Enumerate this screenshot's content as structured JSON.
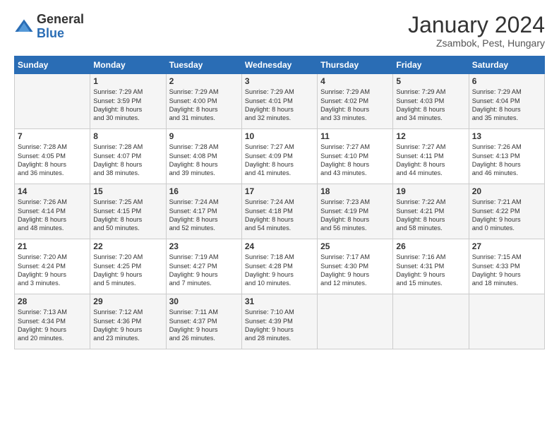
{
  "logo": {
    "general": "General",
    "blue": "Blue"
  },
  "title": "January 2024",
  "location": "Zsambok, Pest, Hungary",
  "days_header": [
    "Sunday",
    "Monday",
    "Tuesday",
    "Wednesday",
    "Thursday",
    "Friday",
    "Saturday"
  ],
  "weeks": [
    [
      {
        "day": "",
        "content": ""
      },
      {
        "day": "1",
        "content": "Sunrise: 7:29 AM\nSunset: 3:59 PM\nDaylight: 8 hours\nand 30 minutes."
      },
      {
        "day": "2",
        "content": "Sunrise: 7:29 AM\nSunset: 4:00 PM\nDaylight: 8 hours\nand 31 minutes."
      },
      {
        "day": "3",
        "content": "Sunrise: 7:29 AM\nSunset: 4:01 PM\nDaylight: 8 hours\nand 32 minutes."
      },
      {
        "day": "4",
        "content": "Sunrise: 7:29 AM\nSunset: 4:02 PM\nDaylight: 8 hours\nand 33 minutes."
      },
      {
        "day": "5",
        "content": "Sunrise: 7:29 AM\nSunset: 4:03 PM\nDaylight: 8 hours\nand 34 minutes."
      },
      {
        "day": "6",
        "content": "Sunrise: 7:29 AM\nSunset: 4:04 PM\nDaylight: 8 hours\nand 35 minutes."
      }
    ],
    [
      {
        "day": "7",
        "content": "Sunrise: 7:28 AM\nSunset: 4:05 PM\nDaylight: 8 hours\nand 36 minutes."
      },
      {
        "day": "8",
        "content": "Sunrise: 7:28 AM\nSunset: 4:07 PM\nDaylight: 8 hours\nand 38 minutes."
      },
      {
        "day": "9",
        "content": "Sunrise: 7:28 AM\nSunset: 4:08 PM\nDaylight: 8 hours\nand 39 minutes."
      },
      {
        "day": "10",
        "content": "Sunrise: 7:27 AM\nSunset: 4:09 PM\nDaylight: 8 hours\nand 41 minutes."
      },
      {
        "day": "11",
        "content": "Sunrise: 7:27 AM\nSunset: 4:10 PM\nDaylight: 8 hours\nand 43 minutes."
      },
      {
        "day": "12",
        "content": "Sunrise: 7:27 AM\nSunset: 4:11 PM\nDaylight: 8 hours\nand 44 minutes."
      },
      {
        "day": "13",
        "content": "Sunrise: 7:26 AM\nSunset: 4:13 PM\nDaylight: 8 hours\nand 46 minutes."
      }
    ],
    [
      {
        "day": "14",
        "content": "Sunrise: 7:26 AM\nSunset: 4:14 PM\nDaylight: 8 hours\nand 48 minutes."
      },
      {
        "day": "15",
        "content": "Sunrise: 7:25 AM\nSunset: 4:15 PM\nDaylight: 8 hours\nand 50 minutes."
      },
      {
        "day": "16",
        "content": "Sunrise: 7:24 AM\nSunset: 4:17 PM\nDaylight: 8 hours\nand 52 minutes."
      },
      {
        "day": "17",
        "content": "Sunrise: 7:24 AM\nSunset: 4:18 PM\nDaylight: 8 hours\nand 54 minutes."
      },
      {
        "day": "18",
        "content": "Sunrise: 7:23 AM\nSunset: 4:19 PM\nDaylight: 8 hours\nand 56 minutes."
      },
      {
        "day": "19",
        "content": "Sunrise: 7:22 AM\nSunset: 4:21 PM\nDaylight: 8 hours\nand 58 minutes."
      },
      {
        "day": "20",
        "content": "Sunrise: 7:21 AM\nSunset: 4:22 PM\nDaylight: 9 hours\nand 0 minutes."
      }
    ],
    [
      {
        "day": "21",
        "content": "Sunrise: 7:20 AM\nSunset: 4:24 PM\nDaylight: 9 hours\nand 3 minutes."
      },
      {
        "day": "22",
        "content": "Sunrise: 7:20 AM\nSunset: 4:25 PM\nDaylight: 9 hours\nand 5 minutes."
      },
      {
        "day": "23",
        "content": "Sunrise: 7:19 AM\nSunset: 4:27 PM\nDaylight: 9 hours\nand 7 minutes."
      },
      {
        "day": "24",
        "content": "Sunrise: 7:18 AM\nSunset: 4:28 PM\nDaylight: 9 hours\nand 10 minutes."
      },
      {
        "day": "25",
        "content": "Sunrise: 7:17 AM\nSunset: 4:30 PM\nDaylight: 9 hours\nand 12 minutes."
      },
      {
        "day": "26",
        "content": "Sunrise: 7:16 AM\nSunset: 4:31 PM\nDaylight: 9 hours\nand 15 minutes."
      },
      {
        "day": "27",
        "content": "Sunrise: 7:15 AM\nSunset: 4:33 PM\nDaylight: 9 hours\nand 18 minutes."
      }
    ],
    [
      {
        "day": "28",
        "content": "Sunrise: 7:13 AM\nSunset: 4:34 PM\nDaylight: 9 hours\nand 20 minutes."
      },
      {
        "day": "29",
        "content": "Sunrise: 7:12 AM\nSunset: 4:36 PM\nDaylight: 9 hours\nand 23 minutes."
      },
      {
        "day": "30",
        "content": "Sunrise: 7:11 AM\nSunset: 4:37 PM\nDaylight: 9 hours\nand 26 minutes."
      },
      {
        "day": "31",
        "content": "Sunrise: 7:10 AM\nSunset: 4:39 PM\nDaylight: 9 hours\nand 28 minutes."
      },
      {
        "day": "",
        "content": ""
      },
      {
        "day": "",
        "content": ""
      },
      {
        "day": "",
        "content": ""
      }
    ]
  ]
}
